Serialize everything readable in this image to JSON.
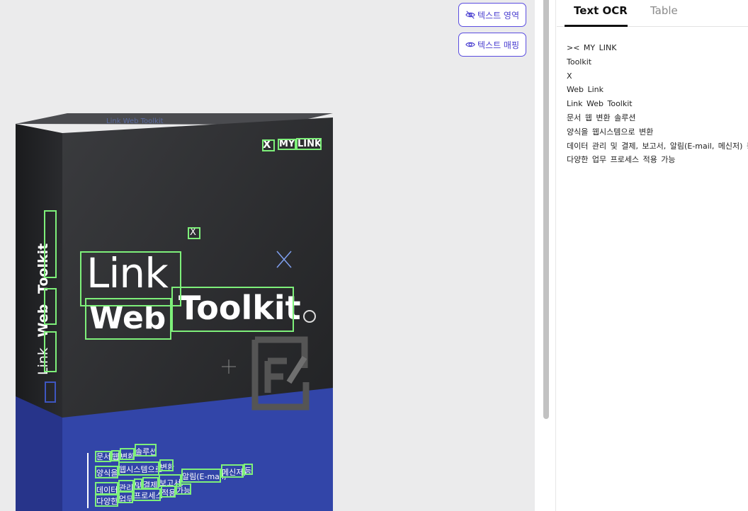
{
  "buttons": {
    "text_area": "텍스트 영역",
    "text_mapping": "텍스트 매핑"
  },
  "box": {
    "brand_mark": "X",
    "brand_my": "MY",
    "brand_link": "LINK",
    "title_link": "Link",
    "title_web": "Web",
    "title_toolkit": "Toolkit",
    "side_link": "Link",
    "side_web": "Web",
    "side_toolkit": "Toolkit",
    "line1": [
      "문서",
      "웹",
      "변환",
      "솔루션"
    ],
    "line2": [
      "양식을",
      "웹시스템으로",
      "변환"
    ],
    "line3": [
      "데이터",
      "관리",
      "및",
      "결제,",
      "보고서,",
      "알림(E-mail,",
      "메신저)",
      "등"
    ],
    "line4": [
      "다양한",
      "업무",
      "프로세스",
      "적용",
      "가능"
    ]
  },
  "tabs": {
    "ocr": "Text OCR",
    "table": "Table"
  },
  "ocr_lines": [
    "><  MY  LINK",
    "Toolkit",
    "X",
    "Web  Link",
    "Link  Web  Toolkit",
    "문서  웹  변환  솔루션",
    "양식을  웹시스템으로  변환",
    "데이터  관리  및  결제,  보고서,  알림(E-mail,  메신저)  등",
    "다양한  업무  프로세스  적용  가능"
  ],
  "colors": {
    "accent": "#4a3fd0",
    "ocr_box": "#7ef07a",
    "box_dark": "#2b2c2e",
    "box_blue": "#3245a8"
  }
}
